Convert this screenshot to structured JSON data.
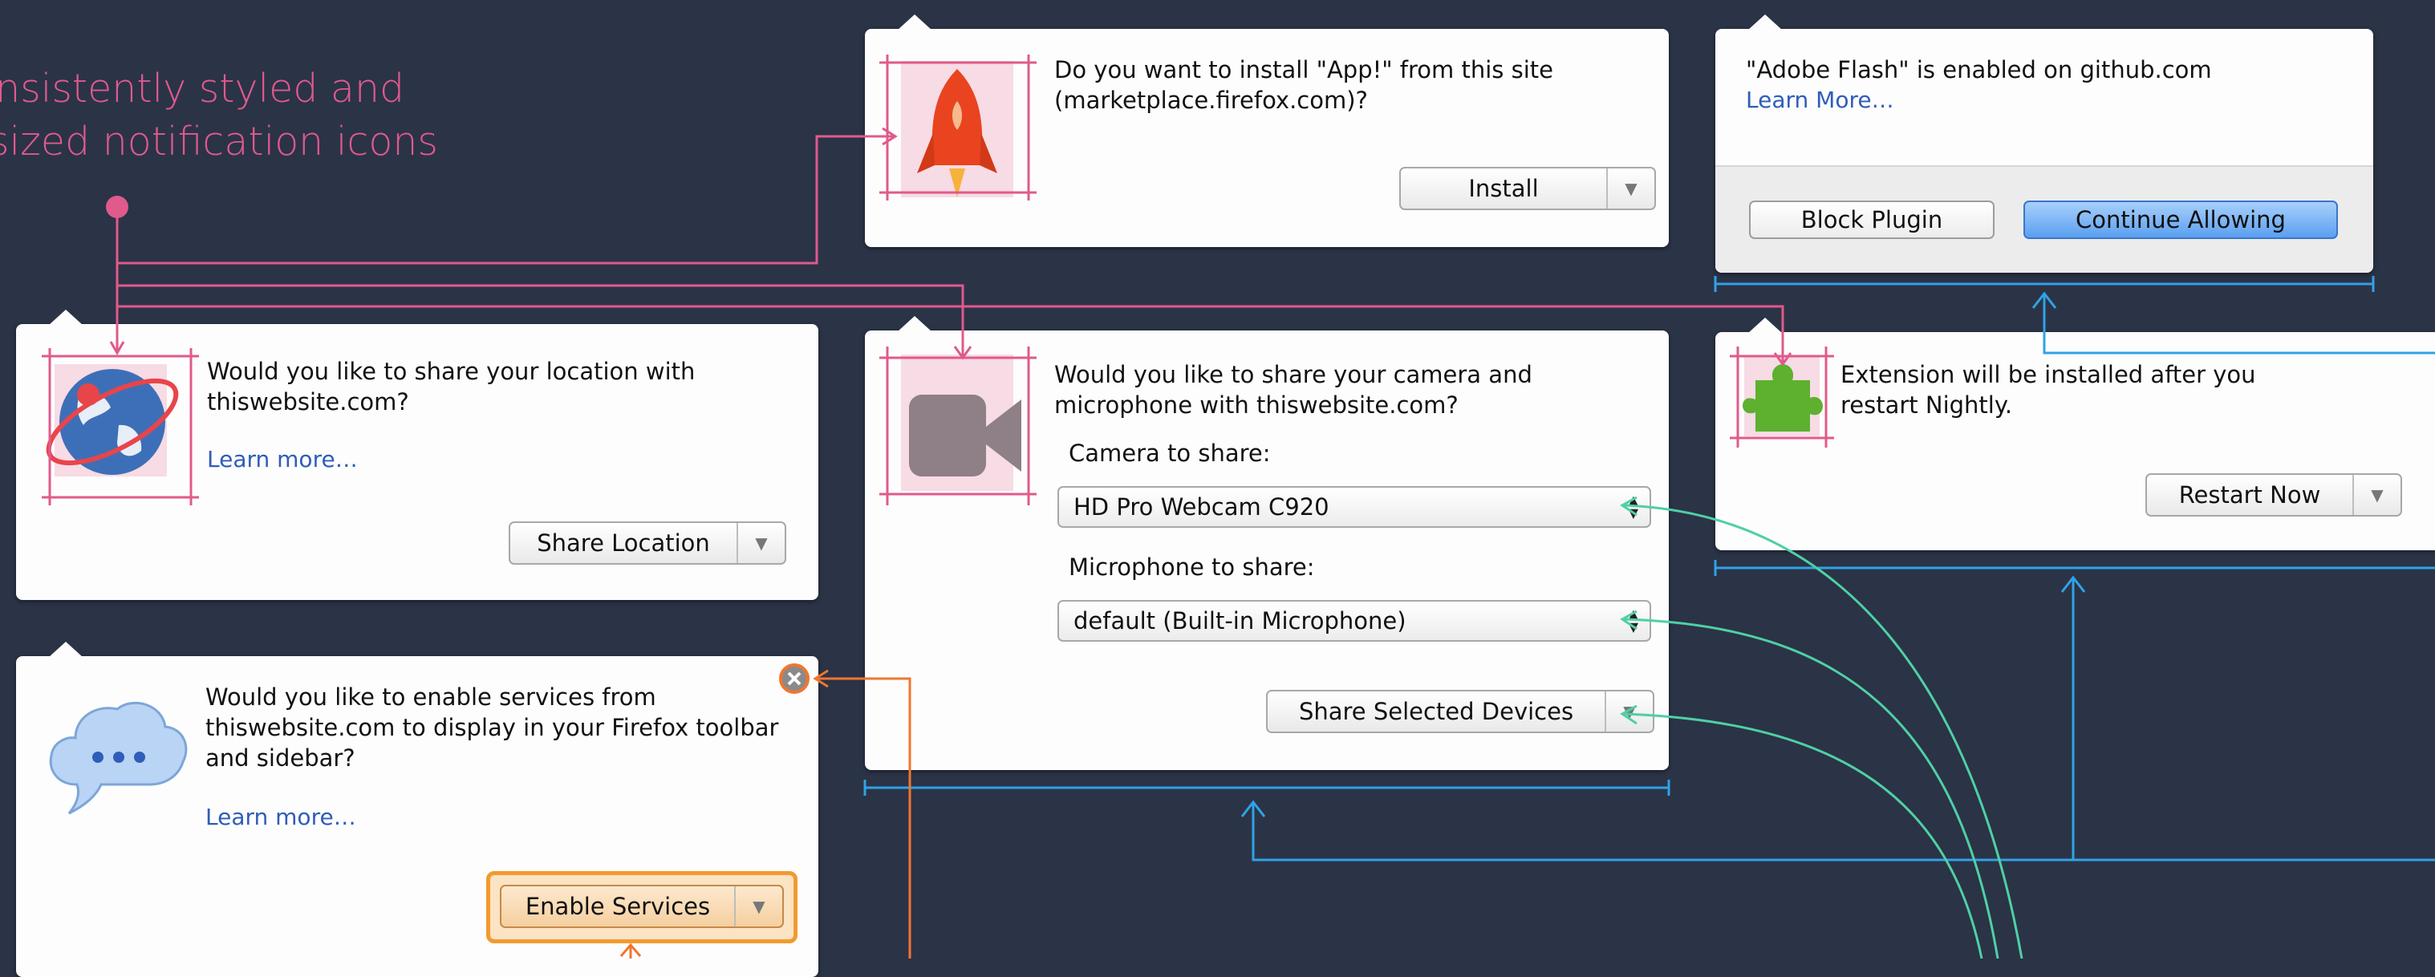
{
  "annotation": {
    "line1": "Consistently styled and",
    "line2": "sized notification icons"
  },
  "install_panel": {
    "text": "Do you want to install \"App!\" from this site (marketplace.firefox.com)?",
    "button": "Install",
    "icon": "rocket-icon"
  },
  "flash_panel": {
    "text": "\"Adobe Flash\" is enabled on github.com",
    "learn": "Learn More…",
    "block_button": "Block Plugin",
    "continue_button": "Continue Allowing"
  },
  "location_panel": {
    "text": "Would you like to share your location with thiswebsite.com?",
    "learn": "Learn more…",
    "button": "Share Location",
    "icon": "globe-icon"
  },
  "camera_panel": {
    "text": "Would you like to share your camera and microphone with thiswebsite.com?",
    "camera_label": "Camera to share:",
    "camera_value": "HD Pro Webcam C920",
    "mic_label": "Microphone to share:",
    "mic_value": "default (Built-in Microphone)",
    "button": "Share Selected Devices",
    "icon": "video-camera-icon"
  },
  "extension_panel": {
    "text": "Extension will be installed after you restart Nightly.",
    "button": "Restart Now",
    "icon": "puzzle-piece-icon"
  },
  "services_panel": {
    "text": "Would you like to enable services from thiswebsite.com to display in your Firefox toolbar and sidebar?",
    "learn": "Learn more…",
    "button": "Enable Services",
    "icon": "chat-bubble-icon"
  },
  "colors": {
    "background": "#2b3347",
    "annotation_pink": "#e05a8c",
    "annotation_blue": "#2fa3e6",
    "annotation_green": "#4fd0a4",
    "annotation_orange": "#f0762e",
    "highlight_orange": "#f29a2e"
  }
}
